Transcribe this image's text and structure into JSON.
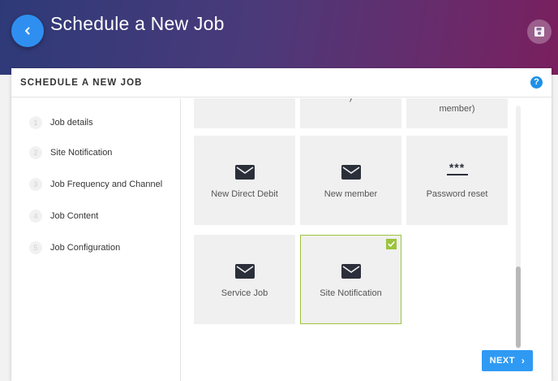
{
  "header": {
    "title": "Schedule a New Job",
    "back_icon": "chevron-left-icon",
    "save_icon": "floppy-disk-icon",
    "gradient": [
      "#2e3a78",
      "#7a1f5e"
    ]
  },
  "card": {
    "title": "SCHEDULE A NEW JOB",
    "help_label": "?"
  },
  "steps": [
    {
      "number": "1",
      "label": "Job details"
    },
    {
      "number": "2",
      "label": "Site Notification"
    },
    {
      "number": "3",
      "label": "Job Frequency and Channel"
    },
    {
      "number": "4",
      "label": "Job Content"
    },
    {
      "number": "5",
      "label": "Job Configuration"
    }
  ],
  "tiles": {
    "partial_top": [
      {
        "label": ""
      },
      {
        "label": ")"
      },
      {
        "label": "member)"
      }
    ],
    "row1": [
      {
        "label": "New Direct Debit",
        "icon": "envelope-icon"
      },
      {
        "label": "New member",
        "icon": "envelope-icon"
      },
      {
        "label": "Password reset",
        "icon": "password-icon",
        "glyph": "***"
      }
    ],
    "row2": [
      {
        "label": "Service Job",
        "icon": "envelope-icon",
        "selected": false
      },
      {
        "label": "Site Notification",
        "icon": "envelope-icon",
        "selected": true
      }
    ]
  },
  "footer": {
    "next_label": "NEXT"
  },
  "colors": {
    "accent": "#2f9af3",
    "selected": "#9cc43c",
    "tile_bg": "#f0f0f0"
  }
}
